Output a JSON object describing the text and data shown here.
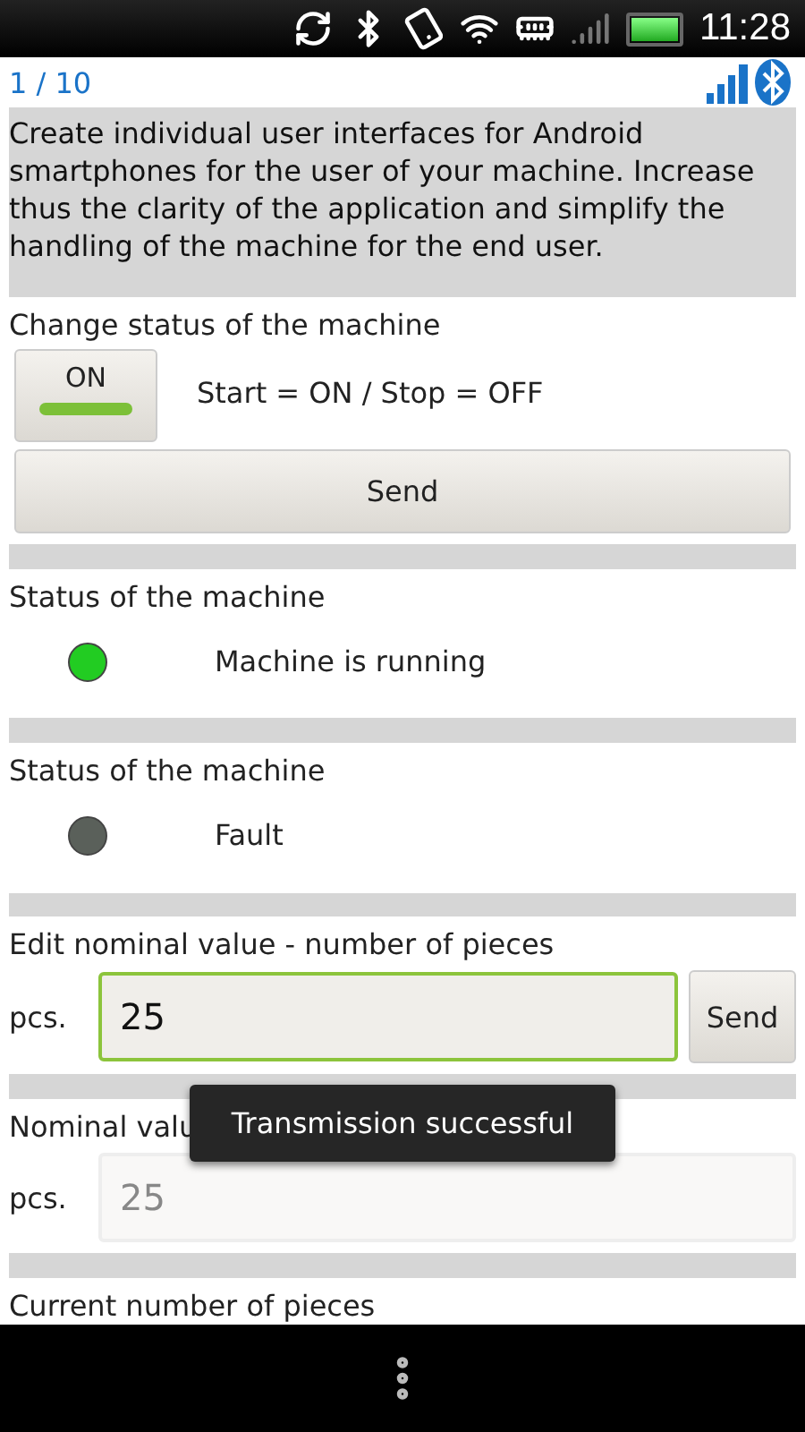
{
  "status_bar": {
    "time": "11:28"
  },
  "header": {
    "page": "1 / 10"
  },
  "description": "Create individual user interfaces for Android smartphones for the user of your machine. Increase thus the clarity of the application and simplify the handling of the machine for the end user.",
  "sections": [
    {
      "kind": "toggle",
      "label": "Change status of the machine",
      "toggle": {
        "text": "ON",
        "on": true
      },
      "hint": "Start = ON / Stop = OFF",
      "button": "Send"
    },
    {
      "kind": "indicator",
      "label": "Status of the machine",
      "color": "#22cc22",
      "text": "Machine is running"
    },
    {
      "kind": "indicator",
      "label": "Status of the machine",
      "color": "#5a605a",
      "text": "Fault"
    },
    {
      "kind": "input",
      "label": "Edit nominal value - number of pieces",
      "unit": "pcs.",
      "value": "25",
      "focused": true,
      "disabled": false,
      "button": "Send"
    },
    {
      "kind": "input",
      "label": "Nominal valu",
      "unit": "pcs.",
      "value": "25",
      "focused": false,
      "disabled": true
    },
    {
      "kind": "heading",
      "label": "Current number of pieces"
    }
  ],
  "toast": "Transmission successful"
}
